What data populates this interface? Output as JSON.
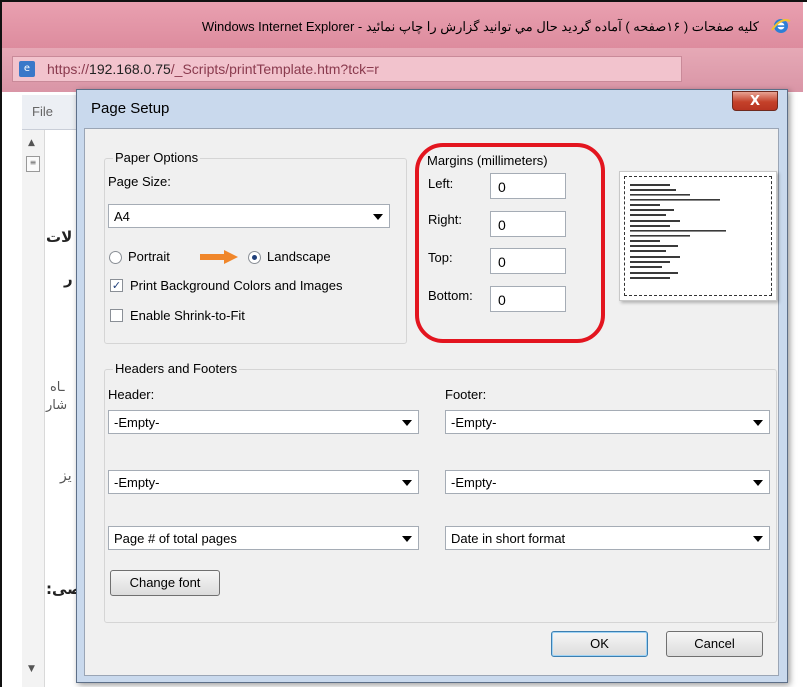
{
  "browser": {
    "window_title": "Windows Internet Explorer - کلیه صفحات ( ۱۶صفحه ) آماده گردید حال مي توانید گزارش را چاپ نمائید",
    "url_prefix": "https://",
    "url_host": "192.168.0.75",
    "url_path": "/_Scripts/printTemplate.htm?tck=r",
    "menu_file": "File"
  },
  "background_page": {
    "fragments": [
      "لات",
      "ر",
      "ـاه",
      "شار",
      "یز",
      "صی:"
    ]
  },
  "dialog": {
    "title": "Page Setup",
    "close_label": "X",
    "paper_options": {
      "legend": "Paper Options",
      "page_size_label": "Page Size:",
      "page_size_value": "A4",
      "portrait_label": "Portrait",
      "landscape_label": "Landscape",
      "orientation_selected": "Landscape",
      "print_background_label": "Print Background Colors and Images",
      "print_background_checked": true,
      "shrink_label": "Enable Shrink-to-Fit",
      "shrink_checked": false
    },
    "margins": {
      "legend": "Margins (millimeters)",
      "left_label": "Left:",
      "left_value": "0",
      "right_label": "Right:",
      "right_value": "0",
      "top_label": "Top:",
      "top_value": "0",
      "bottom_label": "Bottom:",
      "bottom_value": "0"
    },
    "headers_footers": {
      "legend": "Headers and Footers",
      "header_label": "Header:",
      "footer_label": "Footer:",
      "header_1": "-Empty-",
      "header_2": "-Empty-",
      "header_3": "Page # of total pages",
      "footer_1": "-Empty-",
      "footer_2": "-Empty-",
      "footer_3": "Date in short format",
      "change_font_label": "Change font"
    },
    "ok_label": "OK",
    "cancel_label": "Cancel"
  },
  "colors": {
    "highlight_ring": "#e3151f",
    "arrow": "#f0862a",
    "ie_titlebar": "#e9a0b0"
  }
}
